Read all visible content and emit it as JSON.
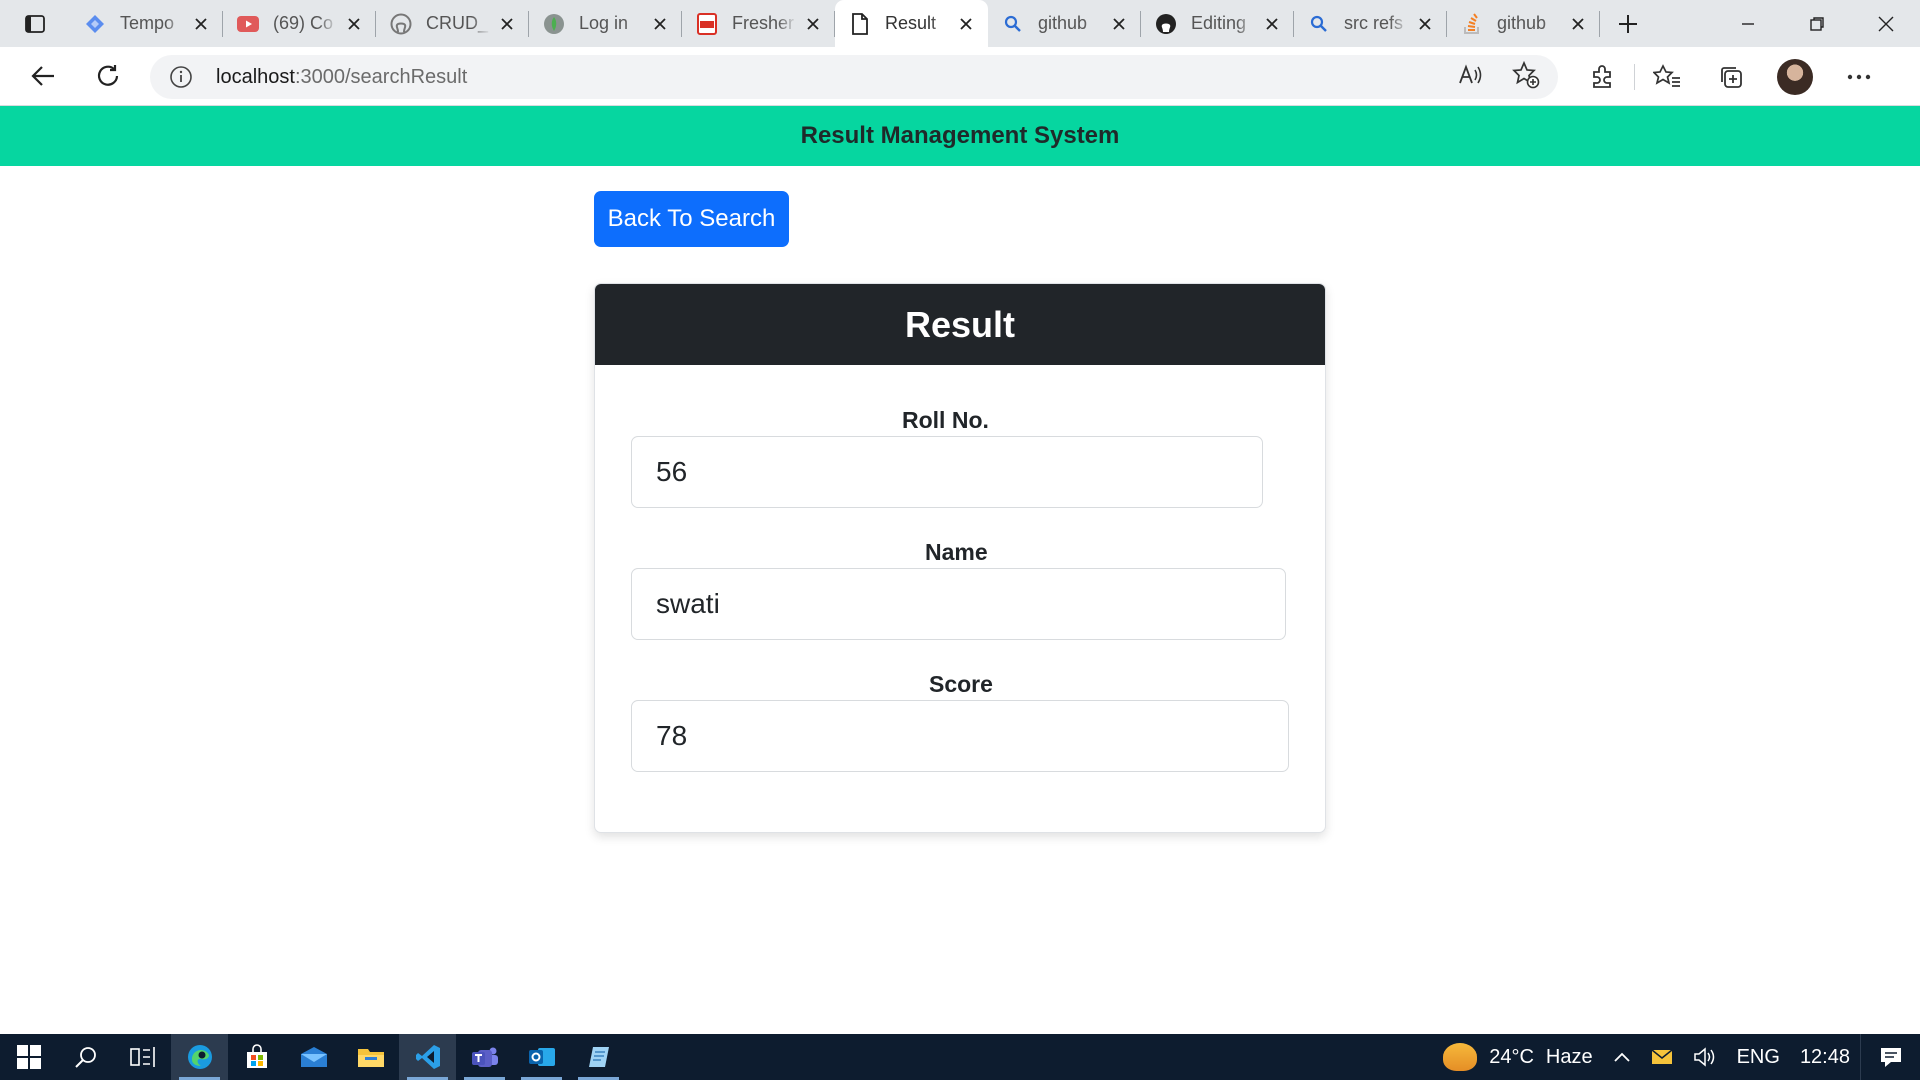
{
  "browser": {
    "tabs": [
      {
        "title": "Tempo",
        "icon": "jira-icon",
        "active": false
      },
      {
        "title": "(69) Co",
        "icon": "youtube-icon",
        "active": false
      },
      {
        "title": "CRUD_",
        "icon": "github-icon",
        "active": false
      },
      {
        "title": "Log in",
        "icon": "mongodb-icon",
        "active": false
      },
      {
        "title": "Fresher",
        "icon": "pdf-icon",
        "active": false
      },
      {
        "title": "Result",
        "icon": "page-icon",
        "active": true
      },
      {
        "title": "github",
        "icon": "search-icon",
        "active": false
      },
      {
        "title": "Editing",
        "icon": "github-icon",
        "active": false
      },
      {
        "title": "src refs",
        "icon": "search-icon",
        "active": false
      },
      {
        "title": "github",
        "icon": "stackoverflow-icon",
        "active": false
      }
    ],
    "address_host": "localhost",
    "address_path": ":3000/searchResult"
  },
  "page": {
    "navbar_title": "Result Management System",
    "back_button": "Back To Search",
    "card_title": "Result",
    "fields": {
      "roll": {
        "label": "Roll No.",
        "value": "56"
      },
      "name": {
        "label": "Name",
        "value": "swati"
      },
      "score": {
        "label": "Score",
        "value": "78"
      }
    }
  },
  "taskbar": {
    "temperature": "24°C",
    "weather": "Haze",
    "language": "ENG",
    "time": "12:48"
  },
  "colors": {
    "navbar": "#06d6a0",
    "primary_button": "#0d6efd",
    "card_header": "#212529"
  }
}
